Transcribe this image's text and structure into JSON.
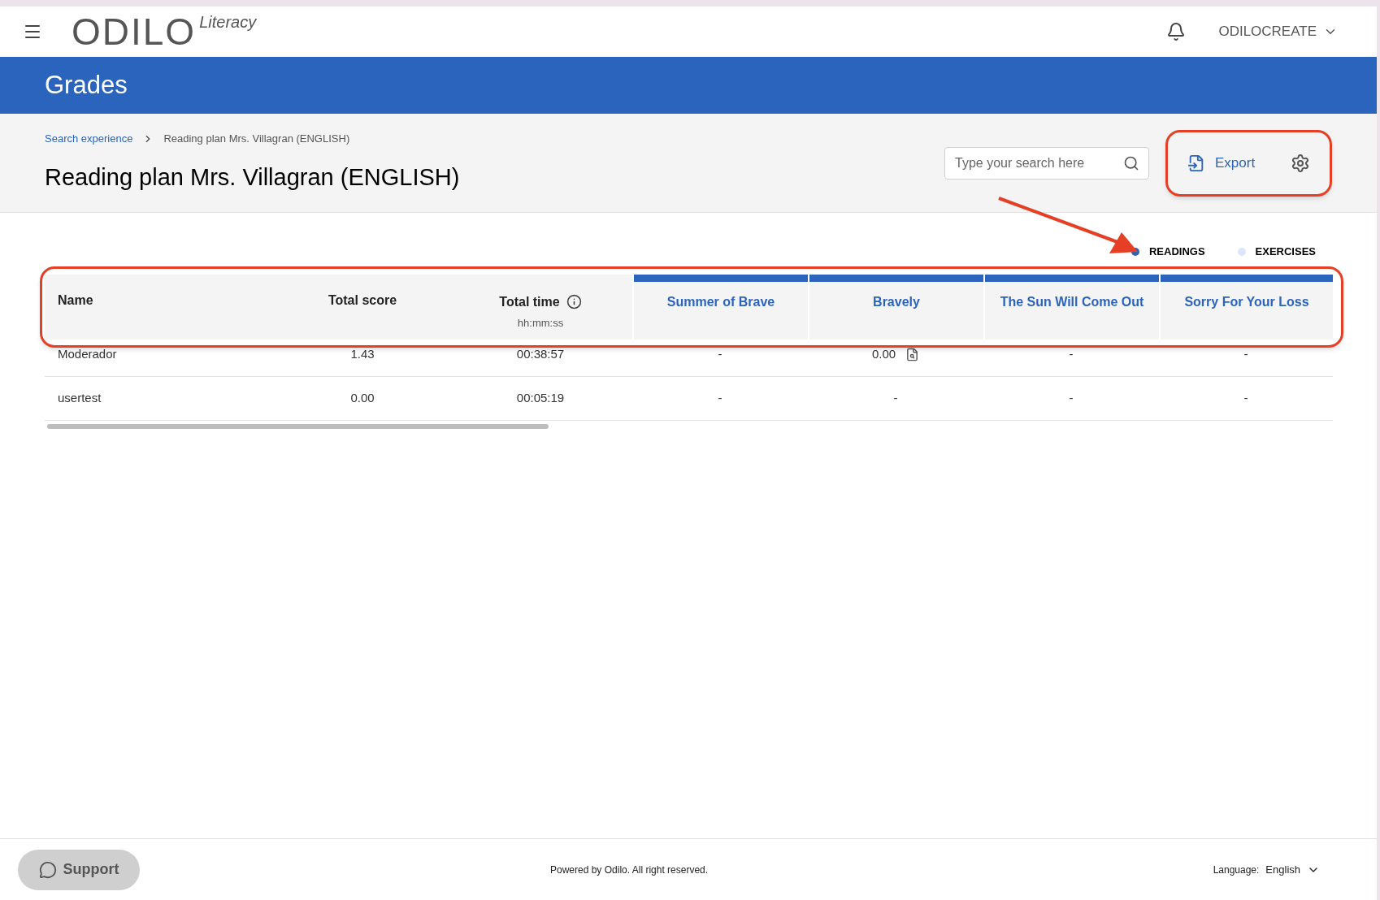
{
  "header": {
    "logo_text": "ODILO",
    "logo_suffix": "Literacy",
    "user": "ODILOCREATE"
  },
  "banner": {
    "title": "Grades"
  },
  "breadcrumb": [
    {
      "label": "Search experience",
      "link": true
    },
    {
      "label": "Reading plan Mrs. Villagran (ENGLISH)",
      "link": false
    }
  ],
  "page_title": "Reading plan Mrs. Villagran (ENGLISH)",
  "search": {
    "placeholder": "Type your search here"
  },
  "export_button": "Export",
  "legend": [
    {
      "label": "READINGS",
      "color": "#2b64bd"
    },
    {
      "label": "EXERCISES",
      "color": "#dbe6fa"
    }
  ],
  "table": {
    "columns": [
      {
        "label": "Name",
        "kind": "name"
      },
      {
        "label": "Total score",
        "kind": "plain"
      },
      {
        "label": "Total time",
        "kind": "time",
        "sublabel": "hh:mm:ss"
      },
      {
        "label": "Summer of Brave",
        "kind": "activity",
        "color": "#2b64bd"
      },
      {
        "label": "Bravely",
        "kind": "activity",
        "color": "#2b64bd"
      },
      {
        "label": "The Sun Will Come Out",
        "kind": "activity",
        "color": "#2b64bd"
      },
      {
        "label": "Sorry For Your Loss",
        "kind": "activity",
        "color": "#2b64bd"
      }
    ],
    "rows": [
      {
        "cells": [
          {
            "text": "Moderador",
            "report": false
          },
          {
            "text": "1.43",
            "report": false
          },
          {
            "text": "00:38:57",
            "report": false
          },
          {
            "text": "-",
            "report": false
          },
          {
            "text": "0.00",
            "report": true
          },
          {
            "text": "-",
            "report": false
          },
          {
            "text": "-",
            "report": false
          }
        ]
      },
      {
        "cells": [
          {
            "text": "usertest",
            "report": false
          },
          {
            "text": "0.00",
            "report": false
          },
          {
            "text": "00:05:19",
            "report": false
          },
          {
            "text": "-",
            "report": false
          },
          {
            "text": "-",
            "report": false
          },
          {
            "text": "-",
            "report": false
          },
          {
            "text": "-",
            "report": false
          }
        ]
      }
    ]
  },
  "footer": {
    "support": "Support",
    "copyright": "Powered by Odilo. All right reserved.",
    "language_label": "Language:",
    "language": "English"
  }
}
